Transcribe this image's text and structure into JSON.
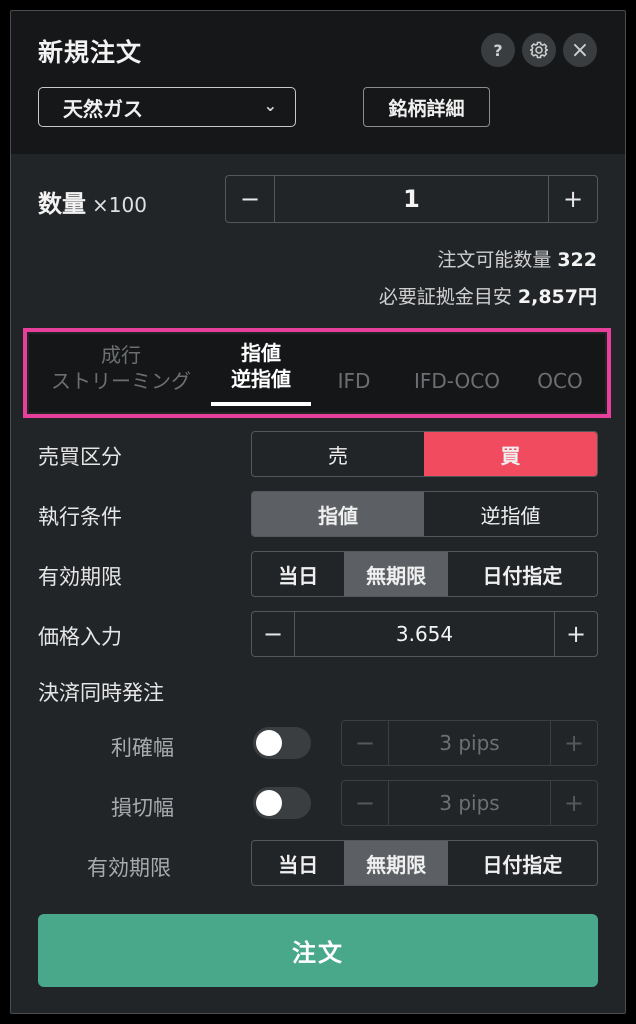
{
  "header": {
    "title": "新規注文",
    "help_icon": "?",
    "settings_icon": "⚙",
    "close_icon": "×",
    "symbol": "天然ガス",
    "symbol_chevron": "⌄",
    "detail_button": "銘柄詳細"
  },
  "quantity": {
    "label": "数量",
    "multiplier": "×100",
    "minus": "−",
    "value": "1",
    "plus": "+",
    "available_label": "注文可能数量",
    "available_value": "322",
    "margin_label": "必要証拠金目安",
    "margin_value": "2,857円"
  },
  "order_types": {
    "tab1_line1": "成行",
    "tab1_line2": "ストリーミング",
    "tab2_line1": "指値",
    "tab2_line2": "逆指値",
    "tab3": "IFD",
    "tab4": "IFD-OCO",
    "tab5": "OCO"
  },
  "side": {
    "label": "売買区分",
    "sell": "売",
    "buy": "買",
    "selected": "buy"
  },
  "execution": {
    "label": "執行条件",
    "limit": "指値",
    "stop": "逆指値",
    "selected": "limit"
  },
  "expiry": {
    "label": "有効期限",
    "today": "当日",
    "indefinite": "無期限",
    "date": "日付指定",
    "selected": "indefinite"
  },
  "price": {
    "label": "価格入力",
    "minus": "−",
    "value": "3.654",
    "plus": "+"
  },
  "settlement": {
    "label": "決済同時発注",
    "take_profit": {
      "label": "利確幅",
      "enabled": false,
      "minus": "−",
      "value": "3 pips",
      "plus": "+"
    },
    "stop_loss": {
      "label": "損切幅",
      "enabled": false,
      "minus": "−",
      "value": "3 pips",
      "plus": "+"
    },
    "expiry": {
      "label": "有効期限",
      "today": "当日",
      "indefinite": "無期限",
      "date": "日付指定",
      "selected": "indefinite"
    }
  },
  "submit": {
    "label": "注文"
  },
  "colors": {
    "buy": "#f04b5e",
    "submit": "#4aa88a",
    "highlight": "#e8409a"
  }
}
